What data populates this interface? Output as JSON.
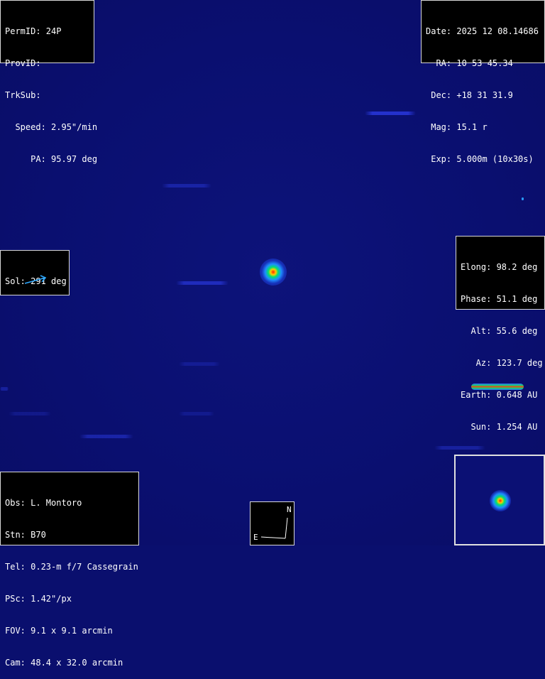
{
  "object_box": {
    "lines": [
      "PermID: 24P",
      "ProvID:",
      "TrkSub:",
      "  Speed: 2.95\"/min",
      "     PA: 95.97 deg"
    ]
  },
  "ephem_box": {
    "lines": [
      "Date: 2025 12 08.14686",
      "  RA: 10 53 45.34",
      " Dec: +18 31 31.9",
      " Mag: 15.1 r",
      " Exp: 5.000m (10x30s)"
    ]
  },
  "sol_box": {
    "label": "Sol: 291 deg",
    "arrow_color": "#2ea8ff"
  },
  "geometry_box": {
    "lines": [
      "Elong: 98.2 deg",
      "Phase: 51.1 deg",
      "  Alt: 55.6 deg",
      "   Az: 123.7 deg",
      "Earth: 0.648 AU",
      "  Sun: 1.254 AU"
    ]
  },
  "observer_box": {
    "lines": [
      "Obs: L. Montoro",
      "Stn: B70",
      "Tel: 0.23-m f/7 Cassegrain",
      "PSc: 1.42\"/px",
      "FOV: 9.1 x 9.1 arcmin",
      "Cam: 48.4 x 32.0 arcmin"
    ]
  },
  "compass": {
    "north": "N",
    "east": "E"
  },
  "colors": {
    "background": "#0a0f6e",
    "streak": "#2a37dc",
    "comet_core": "#ff2200",
    "comet_halo": "#00e070"
  }
}
